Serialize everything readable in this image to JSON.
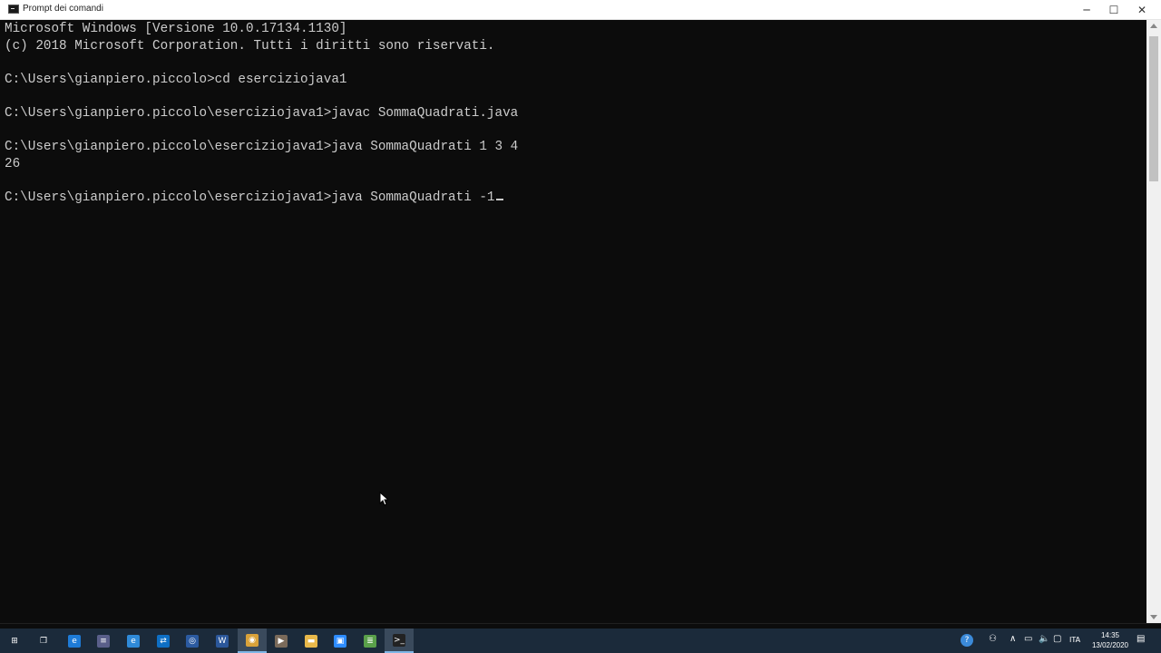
{
  "window": {
    "title": "Prompt dei comandi",
    "controls": {
      "minimize": "─",
      "maximize": "☐",
      "close": "✕"
    }
  },
  "console": {
    "lines": [
      "Microsoft Windows [Versione 10.0.17134.1130]",
      "(c) 2018 Microsoft Corporation. Tutti i diritti sono riservati.",
      "",
      "C:\\Users\\gianpiero.piccolo>cd eserciziojava1",
      "",
      "C:\\Users\\gianpiero.piccolo\\eserciziojava1>javac SommaQuadrati.java",
      "",
      "C:\\Users\\gianpiero.piccolo\\eserciziojava1>java SommaQuadrati 1 3 4",
      "26",
      "",
      "C:\\Users\\gianpiero.piccolo\\eserciziojava1>java SommaQuadrati -1"
    ],
    "text_color": "#cccccc",
    "background": "#0c0c0c"
  },
  "taskbar": {
    "apps": [
      {
        "name": "start-icon",
        "glyph": "⊞",
        "color": "transparent"
      },
      {
        "name": "task-view-icon",
        "glyph": "❐",
        "color": "transparent"
      },
      {
        "name": "edge-icon",
        "glyph": "e",
        "color": "#1e7bd6"
      },
      {
        "name": "app-icon",
        "glyph": "≡",
        "color": "#5a5f8a"
      },
      {
        "name": "ie-icon",
        "glyph": "e",
        "color": "#2f8ad8"
      },
      {
        "name": "teamviewer-icon",
        "glyph": "⇄",
        "color": "#0e6fc4"
      },
      {
        "name": "network-app-icon",
        "glyph": "◎",
        "color": "#2b5aa0"
      },
      {
        "name": "word-icon",
        "glyph": "W",
        "color": "#2b579a"
      },
      {
        "name": "chrome-icon",
        "glyph": "◉",
        "color": "#d9a23a"
      },
      {
        "name": "media-icon",
        "glyph": "▶",
        "color": "#7a6a5a"
      },
      {
        "name": "file-explorer-icon",
        "glyph": "▬",
        "color": "#e8b84a"
      },
      {
        "name": "zoom-icon",
        "glyph": "▣",
        "color": "#2d8cff"
      },
      {
        "name": "notepad-icon",
        "glyph": "≣",
        "color": "#5aa04a"
      },
      {
        "name": "cmd-icon",
        "glyph": ">_",
        "color": "#222222"
      }
    ],
    "tray": {
      "language": "ITA",
      "time": "14:35",
      "date": "13/02/2020"
    }
  }
}
